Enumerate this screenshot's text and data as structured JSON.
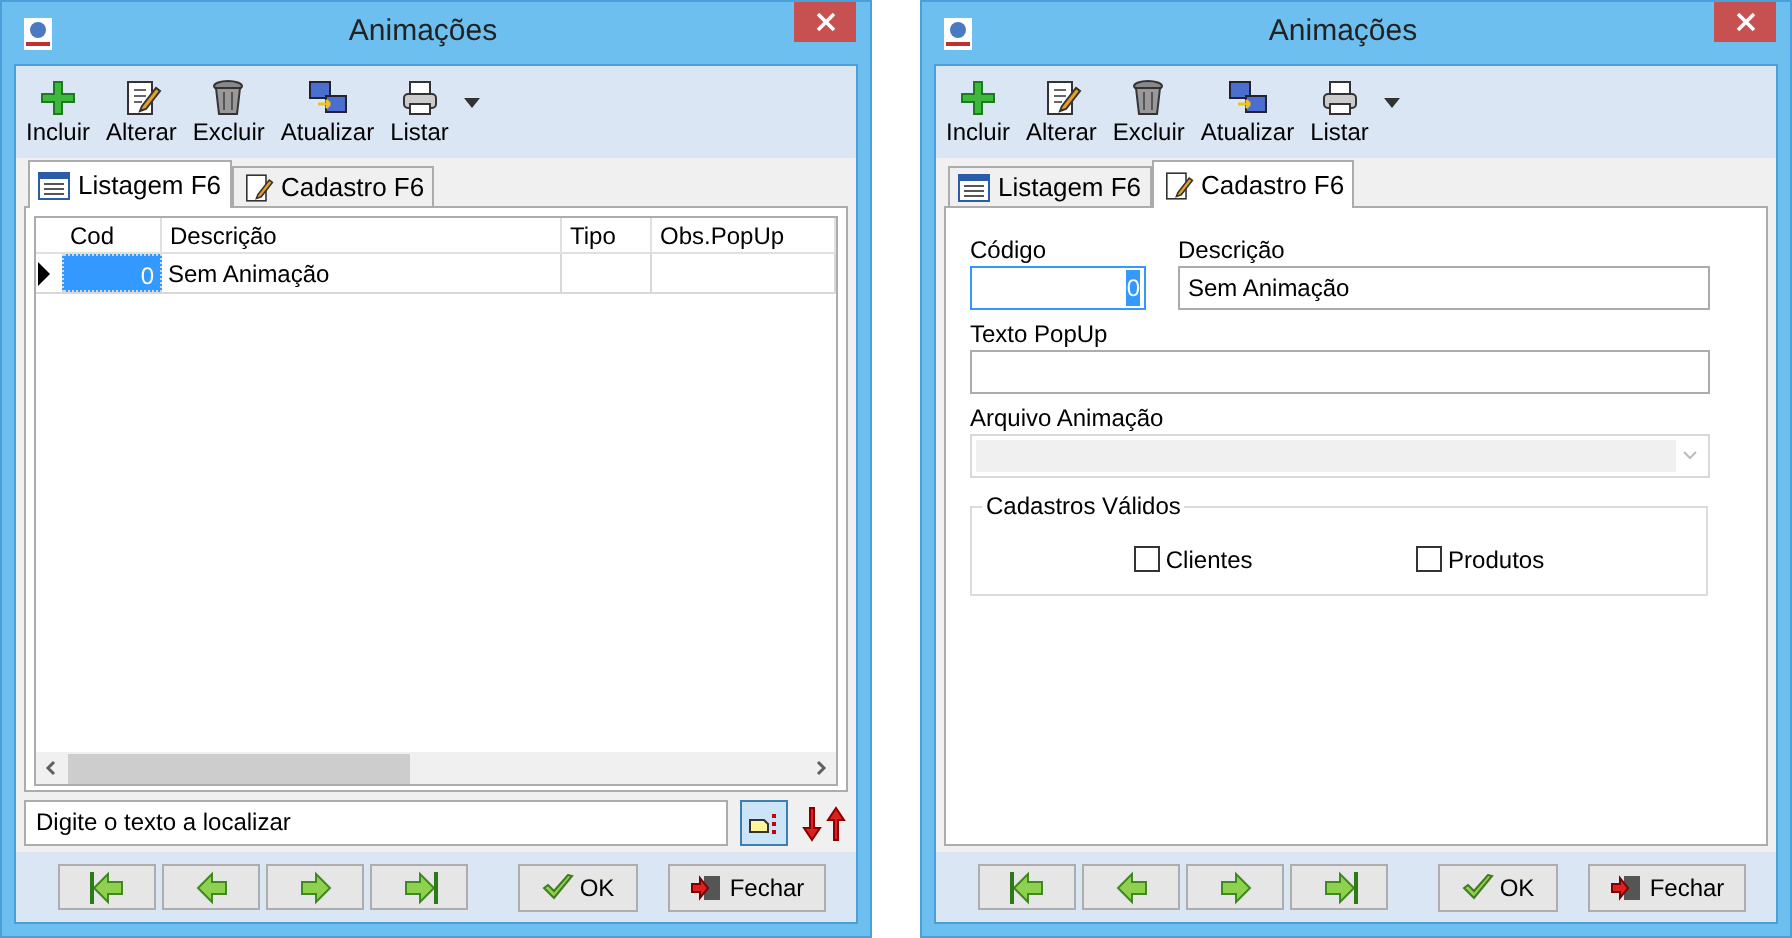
{
  "windows": [
    {
      "title": "Animações",
      "toolbar": [
        "Incluir",
        "Alterar",
        "Excluir",
        "Atualizar",
        "Listar"
      ],
      "tabs": [
        {
          "label": "Listagem F6",
          "selected": true
        },
        {
          "label": "Cadastro F6",
          "selected": false
        }
      ],
      "kind": "list",
      "table": {
        "columns": [
          "Cod",
          "Descrição",
          "Tipo",
          "Obs.PopUp"
        ],
        "rows": [
          {
            "cells": [
              "0",
              "Sem Animação",
              "",
              ""
            ],
            "selected": true
          }
        ]
      },
      "search": {
        "value": "Digite o texto a localizar"
      },
      "buttons": [
        "OK",
        "Fechar"
      ]
    },
    {
      "title": "Animações",
      "toolbar": [
        "Incluir",
        "Alterar",
        "Excluir",
        "Atualizar",
        "Listar"
      ],
      "tabs": [
        {
          "label": "Listagem F6",
          "selected": false
        },
        {
          "label": "Cadastro F6",
          "selected": true
        }
      ],
      "kind": "form",
      "form": {
        "codigo": {
          "label": "Código",
          "value": "0"
        },
        "descricao": {
          "label": "Descrição",
          "value": "Sem Animação"
        },
        "texto": {
          "label": "Texto PopUp"
        },
        "arquivo": {
          "label": "Arquivo Animação",
          "disabled": true
        },
        "group": {
          "title": "Cadastros Válidos",
          "options": [
            {
              "label": "Clientes",
              "checked": false
            },
            {
              "label": "Produtos",
              "checked": false
            }
          ]
        }
      },
      "buttons": [
        "OK",
        "Fechar"
      ]
    }
  ]
}
